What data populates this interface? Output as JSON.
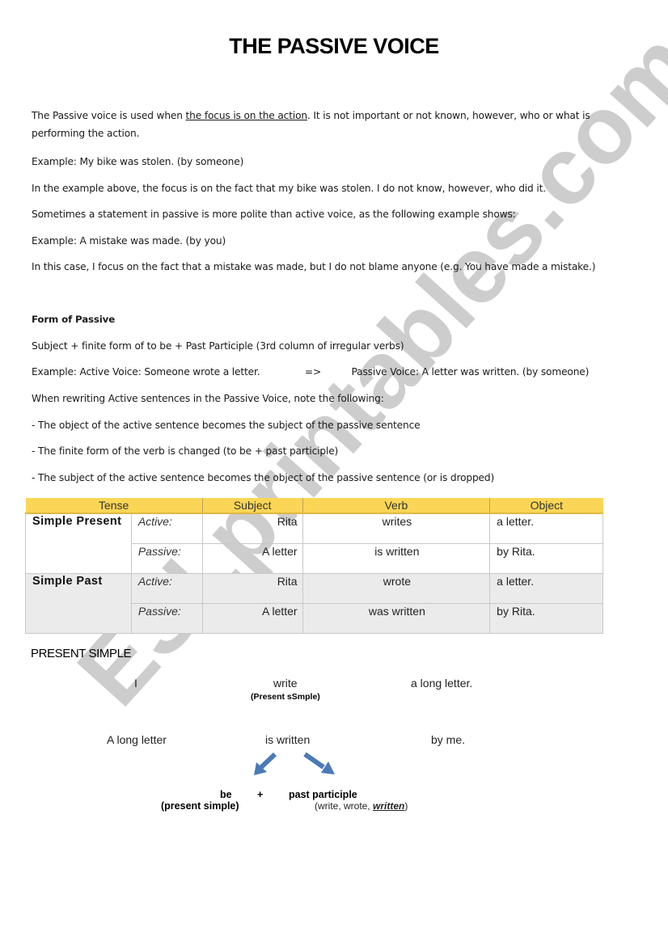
{
  "title": "THE PASSIVE VOICE",
  "intro": {
    "line1_pre": "The Passive voice is used when ",
    "line1_underlined": "the focus is on the action",
    "line1_post": ". It is not important or not known, however, who or what is",
    "line2": "performing the action."
  },
  "paragraphs": [
    "Example: My bike was stolen. (by someone)",
    "In the example above, the focus is on the fact that my bike was stolen. I do not know, however, who did it.",
    "Sometimes a statement in passive is more polite than active voice, as the following example shows:",
    "Example: A mistake was made. (by you)",
    "In this case, I focus on the fact that a mistake was made, but I do not blame anyone (e.g. You have made a mistake.)"
  ],
  "form": {
    "heading": "Form of Passive",
    "rule": "Subject + finite form of to be + Past Participle (3rd column of irregular verbs)",
    "example_active": "Example: Active Voice: Someone wrote a letter.",
    "example_arrow": "=>",
    "example_passive": "Passive Voice: A letter was written. (by someone)",
    "note_intro": "When rewriting Active sentences in the Passive Voice, note the following:",
    "notes": [
      "- The object of the active sentence becomes the subject of the passive sentence",
      "- The finite form of the verb is changed (to be + past participle)",
      "- The subject of the active sentence becomes the object of the passive sentence (or is dropped)"
    ]
  },
  "table": {
    "headers": [
      "Tense",
      "Subject",
      "Verb",
      "Object"
    ],
    "colors": {
      "header_bg": "#fbd656",
      "alt_row_bg": "#ebebeb"
    },
    "groups": [
      {
        "tense": "Simple Present",
        "rows": [
          {
            "voice": "Active:",
            "subject": "Rita",
            "verb": "writes",
            "object": "a letter."
          },
          {
            "voice": "Passive:",
            "subject": "A letter",
            "verb": "is written",
            "object": "by Rita."
          }
        ]
      },
      {
        "tense": "Simple Past",
        "rows": [
          {
            "voice": "Active:",
            "subject": "Rita",
            "verb": "wrote",
            "object": "a letter."
          },
          {
            "voice": "Passive:",
            "subject": "A letter",
            "verb": "was written",
            "object": "by Rita."
          }
        ]
      }
    ]
  },
  "present_simple": {
    "heading": "PRESENT SIMPLE",
    "active": {
      "subject": "I",
      "verb": "write",
      "object": "a long letter.",
      "verb_note": "(Present sSmple)"
    },
    "passive": {
      "subject": "A long letter",
      "verb": "is written",
      "object": "by me."
    },
    "breakdown": {
      "be": "be",
      "plus": "+",
      "pp": "past participle",
      "be_note": "(present simple)",
      "pp_note_pre": "(write, wrote, ",
      "pp_note_em": "written",
      "pp_note_post": ")"
    },
    "arrow_color": "#4a7ab8"
  },
  "watermark": {
    "text": "ESLprintables.com",
    "color": "#c8c8c8"
  }
}
